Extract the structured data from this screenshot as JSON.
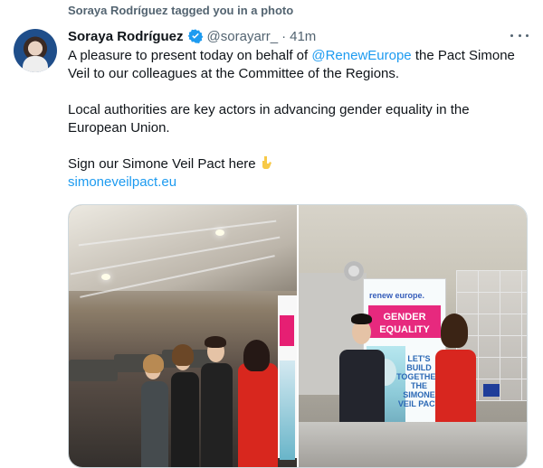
{
  "social_context": {
    "text": "Soraya Rodríguez tagged you in a photo"
  },
  "author": {
    "name": "Soraya Rodríguez",
    "handle": "@sorayarr_",
    "separator": "·",
    "time": "41m",
    "verified": true
  },
  "icons": {
    "verified": "verified-badge-icon",
    "more": "more-options-icon",
    "emoji": "pointing-hand-emoji"
  },
  "tweet": {
    "line1_prefix": "A pleasure to present today on behalf of ",
    "mention": "@RenewEurope",
    "line1_suffix": " the Pact Simone Veil to our colleagues at the Committee of the Regions.",
    "paragraph2": "Local authorities are key actors in advancing gender equality in the European Union.",
    "paragraph3": "Sign our Simone Veil Pact here",
    "link": "simoneveilpact.eu"
  },
  "media": {
    "banner_brand": "renew europe.",
    "banner_title_line1": "GENDER",
    "banner_title_line2": "EQUALITY",
    "banner_slogan": "LET'S BUILD TOGETHER THE SIMONE VEIL PACT"
  },
  "colors": {
    "link": "#1d9bf0",
    "verified": "#1d9bf0",
    "muted": "#536471",
    "banner_pink": "#e7297e",
    "banner_blue": "#2b68b5"
  }
}
